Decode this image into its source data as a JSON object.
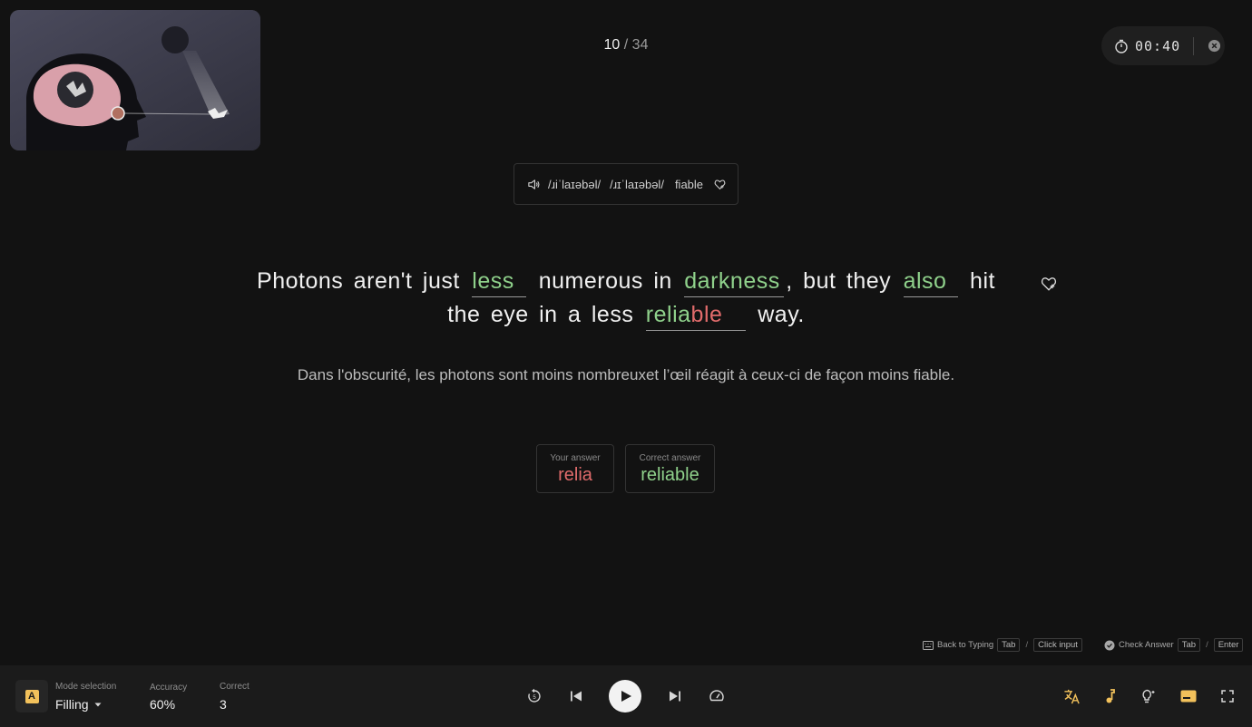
{
  "progress": {
    "current": "10",
    "separator": "/",
    "total": "34"
  },
  "timer": {
    "time": "00:40"
  },
  "pronunciation": {
    "ipa_1": "/ɹiˈlaɪəbəl/",
    "ipa_2": "/ɹɪˈlaɪəbəl/",
    "translation": "fiable"
  },
  "sentence": {
    "t1": "Photons aren't just",
    "b1": "less",
    "t2": "numerous in",
    "b2": "darkness",
    "t3": ", but they",
    "b3": "also",
    "t4": "hit the eye in a less",
    "b4_correct_part": "relia",
    "b4_wrong_part": "ble",
    "t5": "way."
  },
  "translation": "Dans l'obscurité, les photons sont moins nombreuxet l’œil réagit à ceux-ci de façon moins fiable.",
  "answers": {
    "your_label": "Your answer",
    "your_value": "relia",
    "correct_label": "Correct answer",
    "correct_value": "reliable"
  },
  "hints": {
    "back_label": "Back to Typing",
    "back_key": "Tab",
    "back_alt": "Click input",
    "check_label": "Check Answer",
    "check_key": "Tab",
    "check_alt": "Enter",
    "sep": "/"
  },
  "bottom": {
    "mode_badge": "A",
    "mode_label": "Mode selection",
    "mode_value": "Filling",
    "accuracy_label": "Accuracy",
    "accuracy_value": "60%",
    "correct_label": "Correct",
    "correct_value": "3"
  },
  "colors": {
    "correct": "#8fd18b",
    "wrong": "#e06b6b",
    "accent": "#f2c15b"
  },
  "icons": [
    "speaker-icon",
    "heart-add-icon",
    "stopwatch-icon",
    "close-circle-icon",
    "replay-icon",
    "skip-back-icon",
    "play-icon",
    "skip-forward-icon",
    "speed-icon",
    "translate-icon",
    "music-note-icon",
    "lightbulb-icon",
    "subtitle-icon",
    "fullscreen-icon"
  ]
}
